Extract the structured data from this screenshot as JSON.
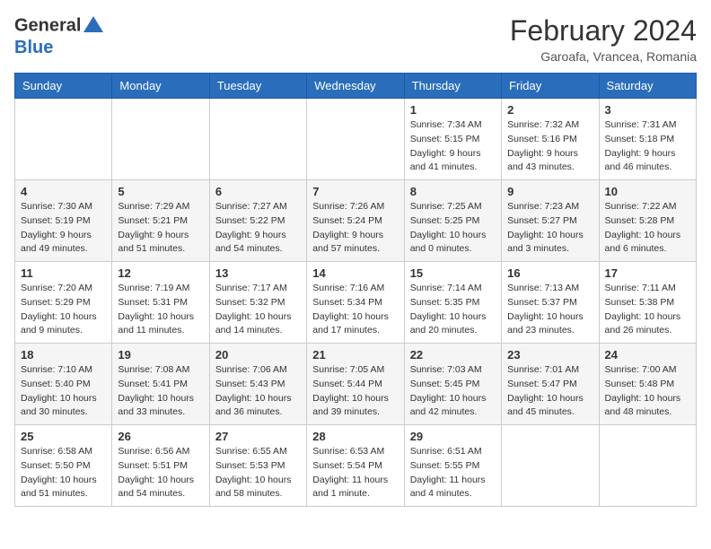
{
  "header": {
    "logo_line1": "General",
    "logo_line2": "Blue",
    "month_title": "February 2024",
    "location": "Garoafa, Vrancea, Romania"
  },
  "calendar": {
    "days_of_week": [
      "Sunday",
      "Monday",
      "Tuesday",
      "Wednesday",
      "Thursday",
      "Friday",
      "Saturday"
    ],
    "weeks": [
      [
        {
          "day": "",
          "info": ""
        },
        {
          "day": "",
          "info": ""
        },
        {
          "day": "",
          "info": ""
        },
        {
          "day": "",
          "info": ""
        },
        {
          "day": "1",
          "info": "Sunrise: 7:34 AM\nSunset: 5:15 PM\nDaylight: 9 hours\nand 41 minutes."
        },
        {
          "day": "2",
          "info": "Sunrise: 7:32 AM\nSunset: 5:16 PM\nDaylight: 9 hours\nand 43 minutes."
        },
        {
          "day": "3",
          "info": "Sunrise: 7:31 AM\nSunset: 5:18 PM\nDaylight: 9 hours\nand 46 minutes."
        }
      ],
      [
        {
          "day": "4",
          "info": "Sunrise: 7:30 AM\nSunset: 5:19 PM\nDaylight: 9 hours\nand 49 minutes."
        },
        {
          "day": "5",
          "info": "Sunrise: 7:29 AM\nSunset: 5:21 PM\nDaylight: 9 hours\nand 51 minutes."
        },
        {
          "day": "6",
          "info": "Sunrise: 7:27 AM\nSunset: 5:22 PM\nDaylight: 9 hours\nand 54 minutes."
        },
        {
          "day": "7",
          "info": "Sunrise: 7:26 AM\nSunset: 5:24 PM\nDaylight: 9 hours\nand 57 minutes."
        },
        {
          "day": "8",
          "info": "Sunrise: 7:25 AM\nSunset: 5:25 PM\nDaylight: 10 hours\nand 0 minutes."
        },
        {
          "day": "9",
          "info": "Sunrise: 7:23 AM\nSunset: 5:27 PM\nDaylight: 10 hours\nand 3 minutes."
        },
        {
          "day": "10",
          "info": "Sunrise: 7:22 AM\nSunset: 5:28 PM\nDaylight: 10 hours\nand 6 minutes."
        }
      ],
      [
        {
          "day": "11",
          "info": "Sunrise: 7:20 AM\nSunset: 5:29 PM\nDaylight: 10 hours\nand 9 minutes."
        },
        {
          "day": "12",
          "info": "Sunrise: 7:19 AM\nSunset: 5:31 PM\nDaylight: 10 hours\nand 11 minutes."
        },
        {
          "day": "13",
          "info": "Sunrise: 7:17 AM\nSunset: 5:32 PM\nDaylight: 10 hours\nand 14 minutes."
        },
        {
          "day": "14",
          "info": "Sunrise: 7:16 AM\nSunset: 5:34 PM\nDaylight: 10 hours\nand 17 minutes."
        },
        {
          "day": "15",
          "info": "Sunrise: 7:14 AM\nSunset: 5:35 PM\nDaylight: 10 hours\nand 20 minutes."
        },
        {
          "day": "16",
          "info": "Sunrise: 7:13 AM\nSunset: 5:37 PM\nDaylight: 10 hours\nand 23 minutes."
        },
        {
          "day": "17",
          "info": "Sunrise: 7:11 AM\nSunset: 5:38 PM\nDaylight: 10 hours\nand 26 minutes."
        }
      ],
      [
        {
          "day": "18",
          "info": "Sunrise: 7:10 AM\nSunset: 5:40 PM\nDaylight: 10 hours\nand 30 minutes."
        },
        {
          "day": "19",
          "info": "Sunrise: 7:08 AM\nSunset: 5:41 PM\nDaylight: 10 hours\nand 33 minutes."
        },
        {
          "day": "20",
          "info": "Sunrise: 7:06 AM\nSunset: 5:43 PM\nDaylight: 10 hours\nand 36 minutes."
        },
        {
          "day": "21",
          "info": "Sunrise: 7:05 AM\nSunset: 5:44 PM\nDaylight: 10 hours\nand 39 minutes."
        },
        {
          "day": "22",
          "info": "Sunrise: 7:03 AM\nSunset: 5:45 PM\nDaylight: 10 hours\nand 42 minutes."
        },
        {
          "day": "23",
          "info": "Sunrise: 7:01 AM\nSunset: 5:47 PM\nDaylight: 10 hours\nand 45 minutes."
        },
        {
          "day": "24",
          "info": "Sunrise: 7:00 AM\nSunset: 5:48 PM\nDaylight: 10 hours\nand 48 minutes."
        }
      ],
      [
        {
          "day": "25",
          "info": "Sunrise: 6:58 AM\nSunset: 5:50 PM\nDaylight: 10 hours\nand 51 minutes."
        },
        {
          "day": "26",
          "info": "Sunrise: 6:56 AM\nSunset: 5:51 PM\nDaylight: 10 hours\nand 54 minutes."
        },
        {
          "day": "27",
          "info": "Sunrise: 6:55 AM\nSunset: 5:53 PM\nDaylight: 10 hours\nand 58 minutes."
        },
        {
          "day": "28",
          "info": "Sunrise: 6:53 AM\nSunset: 5:54 PM\nDaylight: 11 hours\nand 1 minute."
        },
        {
          "day": "29",
          "info": "Sunrise: 6:51 AM\nSunset: 5:55 PM\nDaylight: 11 hours\nand 4 minutes."
        },
        {
          "day": "",
          "info": ""
        },
        {
          "day": "",
          "info": ""
        }
      ]
    ]
  }
}
